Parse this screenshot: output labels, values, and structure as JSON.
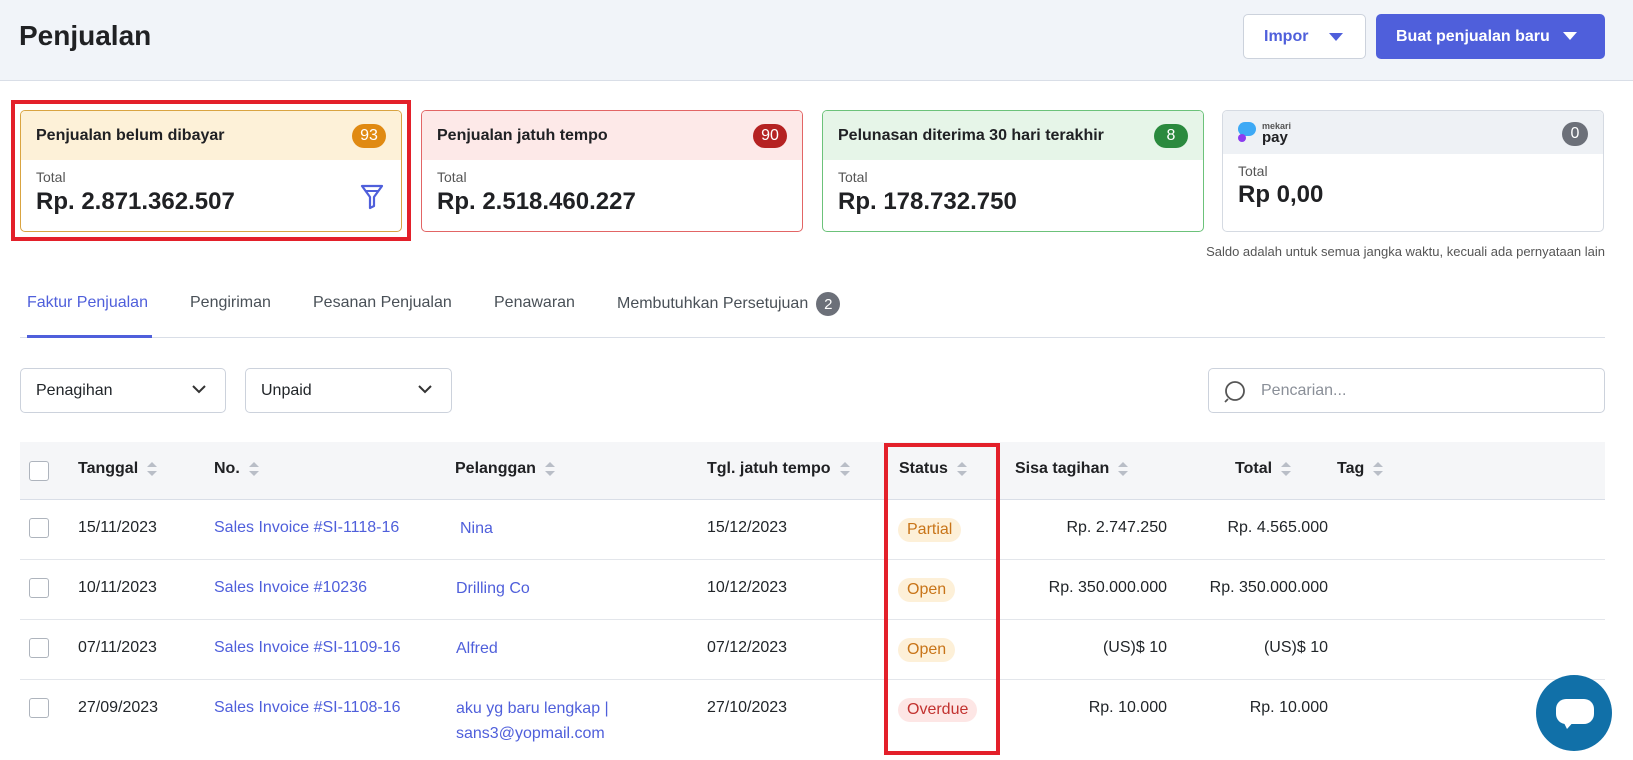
{
  "header": {
    "title": "Penjualan",
    "import_label": "Impor",
    "new_sale_label": "Buat penjualan baru"
  },
  "summary_cards": [
    {
      "title": "Penjualan belum dibayar",
      "count": "93",
      "total_label": "Total",
      "total_value": "Rp. 2.871.362.507",
      "accent": "#e08a12"
    },
    {
      "title": "Penjualan jatuh tempo",
      "count": "90",
      "total_label": "Total",
      "total_value": "Rp. 2.518.460.227",
      "accent": "#b52222"
    },
    {
      "title": "Pelunasan diterima 30 hari terakhir",
      "count": "8",
      "total_label": "Total",
      "total_value": "Rp. 178.732.750",
      "accent": "#2b8a3e"
    },
    {
      "brand_small": "mekari",
      "brand_big": "pay",
      "count": "0",
      "total_label": "Total",
      "total_value": "Rp 0,00",
      "accent": "#6c7079"
    }
  ],
  "balance_note": "Saldo adalah untuk semua jangka waktu, kecuali ada pernyataan lain",
  "tabs": [
    {
      "label": "Faktur Penjualan",
      "active": true
    },
    {
      "label": "Pengiriman",
      "active": false
    },
    {
      "label": "Pesanan Penjualan",
      "active": false
    },
    {
      "label": "Penawaran",
      "active": false
    },
    {
      "label": "Membutuhkan Persetujuan",
      "count": "2",
      "active": false
    }
  ],
  "filters": {
    "type_value": "Penagihan",
    "status_value": "Unpaid",
    "search_placeholder": "Pencarian..."
  },
  "table": {
    "columns": [
      "Tanggal",
      "No.",
      "Pelanggan",
      "Tgl. jatuh tempo",
      "Status",
      "Sisa tagihan",
      "Total",
      "Tag"
    ],
    "rows": [
      {
        "date": "15/11/2023",
        "number": "Sales Invoice #SI-1118-16",
        "customer": "Nina",
        "customer2": "",
        "due": "15/12/2023",
        "status": "Partial",
        "balance": "Rp. 2.747.250",
        "total": "Rp. 4.565.000",
        "tag": ""
      },
      {
        "date": "10/11/2023",
        "number": "Sales Invoice #10236",
        "customer": "Drilling Co",
        "customer2": "",
        "due": "10/12/2023",
        "status": "Open",
        "balance": "Rp. 350.000.000",
        "total": "Rp. 350.000.000",
        "tag": ""
      },
      {
        "date": "07/11/2023",
        "number": "Sales Invoice #SI-1109-16",
        "customer": "Alfred",
        "customer2": "",
        "due": "07/12/2023",
        "status": "Open",
        "balance": "(US)$ 10",
        "total": "(US)$ 10",
        "tag": ""
      },
      {
        "date": "27/09/2023",
        "number": "Sales Invoice #SI-1108-16",
        "customer": "aku yg baru lengkap |",
        "customer2": "sans3@yopmail.com",
        "due": "27/10/2023",
        "status": "Overdue",
        "balance": "Rp. 10.000",
        "total": "Rp. 10.000",
        "tag": ""
      }
    ]
  },
  "colors": {
    "primary": "#4f5fdb",
    "highlight": "#e3202a",
    "status_partial": "#c87418",
    "status_open": "#c87418",
    "status_overdue": "#c2322f"
  }
}
